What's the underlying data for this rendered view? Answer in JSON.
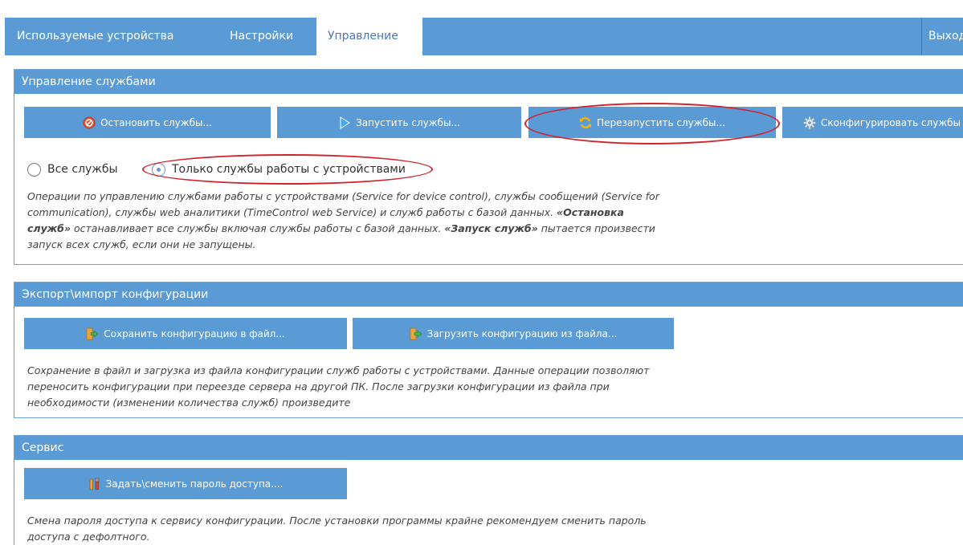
{
  "tabs": [
    {
      "label": "Используемые устройства"
    },
    {
      "label": "Настройки"
    },
    {
      "label": "Управление"
    }
  ],
  "exit_label": "Выход",
  "services": {
    "header": "Управление службами",
    "buttons": {
      "stop": "Остановить службы...",
      "start": "Запустить службы...",
      "restart": "Перезапустить службы...",
      "configure": "Сконфигурировать службы"
    },
    "radio_all": "Все службы",
    "radio_devices": "Только службы работы с устройствами",
    "radio_selected": "devices",
    "desc": {
      "p1": "Операции по управлению службами работы с устройствами (Service for device control), службы сообщений (Service for communication), службы web аналитики (TimeControl web Service) и служб работы с базой данных. ",
      "b1": "«Остановка служб»",
      "p2": " останавливает все службы включая службы работы с базой данных. ",
      "b2": "«Запуск служб»",
      "p3": " пытается произвести запуск всех служб, если они не запущены."
    }
  },
  "export": {
    "header": "Экспорт\\импорт конфигурации",
    "save": "Сохранить конфигурацию в файл...",
    "load": "Загрузить конфигурацию из файла...",
    "desc": "Сохранение в файл и загрузка из файла конфигурации служб работы с устройствами. Данные операции позволяют переносить конфигурации при переезде сервера на другой ПК. После загрузки конфигурации из файла при необходимости (изменении количества служб) произведите"
  },
  "service": {
    "header": "Сервис",
    "password": "Задать\\сменить пароль доступа....",
    "desc": "Смена пароля доступа к сервису конфигурации. После установки программы крайне рекомендуем сменить пароль доступа с дефолтного."
  },
  "colors": {
    "accent": "#5b9bd5",
    "highlight": "#d0242c",
    "stop_icon": "#e0553a",
    "start_icon": "#3fa9f5",
    "restart_icon": "#f5b400",
    "config_icon": "#eeeeee"
  },
  "icons": {
    "stop": "stop-icon",
    "start": "play-icon",
    "restart": "refresh-icon",
    "configure": "gear-icon",
    "save": "export-icon",
    "load": "import-icon",
    "password": "tools-icon"
  }
}
